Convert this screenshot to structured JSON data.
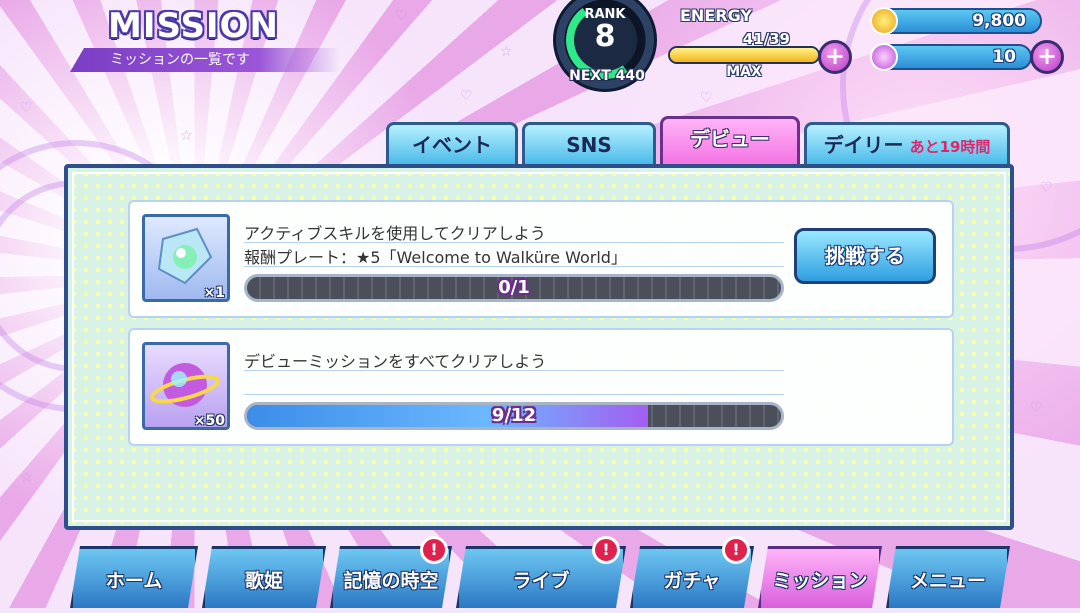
{
  "header": {
    "title": "MISSION",
    "subtitle": "ミッションの一覧です",
    "rank_label": "RANK",
    "rank_value": "8",
    "next_label": "NEXT 440",
    "energy_label": "ENERGY",
    "energy_value": "41/39",
    "energy_max_label": "MAX",
    "energy_fill_fraction": 1.0,
    "coins": "9,800",
    "gems": "10"
  },
  "tabs": [
    {
      "label": "イベント",
      "active": false
    },
    {
      "label": "SNS",
      "active": false
    },
    {
      "label": "デビュー",
      "active": true
    },
    {
      "label": "デイリー",
      "sub": "あと19時間",
      "active": false
    }
  ],
  "missions": [
    {
      "title": "アクティブスキルを使用してクリアしよう",
      "reward": "報酬プレート：★5「Welcome to Walküre World」",
      "quantity": "×1",
      "progress_text": "0/1",
      "progress_fraction": 0.0,
      "button_label": "挑戦する"
    },
    {
      "title": "デビューミッションをすべてクリアしよう",
      "quantity": "×50",
      "progress_text": "9/12",
      "progress_fraction": 0.75
    }
  ],
  "nav": [
    {
      "label": "ホーム",
      "alert": false
    },
    {
      "label": "歌姫",
      "alert": false
    },
    {
      "label": "記憶の時空",
      "alert": true
    },
    {
      "label": "ライブ",
      "alert": true
    },
    {
      "label": "ガチャ",
      "alert": true
    },
    {
      "label": "ミッション",
      "alert": false,
      "active": true
    },
    {
      "label": "メニュー",
      "alert": false
    }
  ],
  "alert_symbol": "!",
  "plus_symbol": "+"
}
